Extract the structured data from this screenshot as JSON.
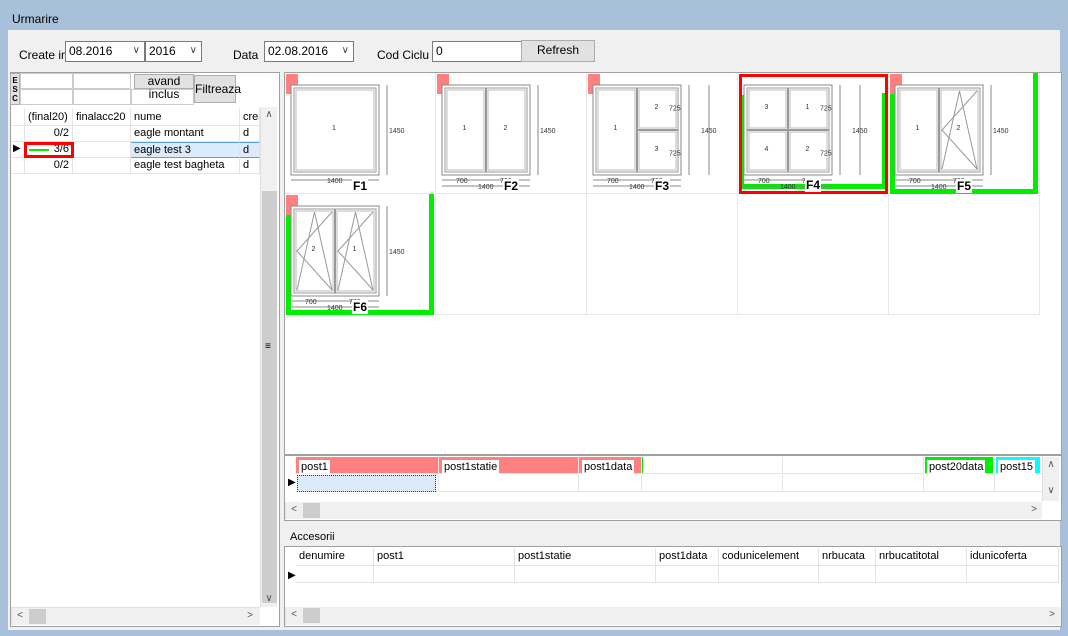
{
  "window": {
    "title": "Urmarire"
  },
  "filters": {
    "create_in_label": "Create in:",
    "month_value": "08.2016",
    "year_value": "2016",
    "data_label": "Data",
    "date_value": "02.08.2016",
    "cod_ciclu_label": "Cod Ciclu",
    "cod_ciclu_value": "0",
    "refresh_label": "Refresh"
  },
  "left_grid": {
    "esc_label": "E S C",
    "avand_inclus_label": "avand inclus",
    "filtreaza_label": "Filtreaza",
    "columns": [
      "(final20)",
      "finalacc20",
      "nume",
      "crea"
    ],
    "rows": [
      {
        "final20": "0/2",
        "finalacc20": "",
        "nume": "eagle montant",
        "crea": "d"
      },
      {
        "final20": "3/6",
        "finalacc20": "",
        "nume": "eagle test 3",
        "crea": "d",
        "selected": true,
        "progress": 0.5
      },
      {
        "final20": "0/2",
        "finalacc20": "",
        "nume": "eagle test bagheta",
        "crea": "d"
      }
    ]
  },
  "colors": {
    "pending": "#ff8080",
    "done": "#00ee00",
    "selected": "#ff0000",
    "cyan": "#00ffff",
    "titlebar": "#a9c0da"
  },
  "windows": [
    {
      "label": "F1",
      "cols": [
        {
          "rows": [
            "1"
          ]
        }
      ],
      "widths": [
        "1400"
      ],
      "total_w": "",
      "heights": [],
      "total_h": "1450",
      "pending": true,
      "done": false,
      "selected": false
    },
    {
      "label": "F2",
      "cols": [
        {
          "rows": [
            "1"
          ]
        },
        {
          "rows": [
            "2"
          ]
        }
      ],
      "widths": [
        "700",
        "700"
      ],
      "total_w": "1400",
      "heights": [],
      "total_h": "1450",
      "pending": true,
      "done": false,
      "selected": false
    },
    {
      "label": "F3",
      "cols": [
        {
          "rows": [
            "1"
          ]
        },
        {
          "rows": [
            "2",
            "3"
          ]
        }
      ],
      "widths": [
        "700",
        "700"
      ],
      "total_w": "1400",
      "heights": [
        "725",
        "725"
      ],
      "total_h": "1450",
      "pending": true,
      "done": false,
      "selected": false
    },
    {
      "label": "F4",
      "cols": [
        {
          "rows": [
            "3",
            "4"
          ]
        },
        {
          "rows": [
            "1",
            "2"
          ]
        }
      ],
      "widths": [
        "700",
        "700"
      ],
      "total_w": "1400",
      "heights": [
        "725",
        "725"
      ],
      "total_h": "1450",
      "pending": false,
      "done": true,
      "selected": true
    },
    {
      "label": "F5",
      "cols": [
        {
          "rows": [
            "1"
          ]
        },
        {
          "rows": [
            "2"
          ],
          "sash": true
        }
      ],
      "widths": [
        "700",
        "700"
      ],
      "total_w": "1400",
      "heights": [],
      "total_h": "1450",
      "pending": true,
      "done": true,
      "selected": false
    },
    {
      "label": "F6",
      "cols": [
        {
          "rows": [
            "2"
          ],
          "sash": true
        },
        {
          "rows": [
            "1"
          ],
          "sash": true
        }
      ],
      "widths": [
        "700",
        "700"
      ],
      "total_w": "1400",
      "heights": [],
      "total_h": "1450",
      "pending": true,
      "done": true,
      "selected": false
    }
  ],
  "posts_grid": {
    "columns": [
      "post1",
      "post1statie",
      "post1data",
      "",
      "",
      "post20data",
      "post15"
    ]
  },
  "accesorii": {
    "label": "Accesorii",
    "columns": [
      "denumire",
      "post1",
      "post1statie",
      "post1data",
      "codunicelement",
      "nrbucata",
      "nrbucatitotal",
      "idunicoferta"
    ]
  }
}
